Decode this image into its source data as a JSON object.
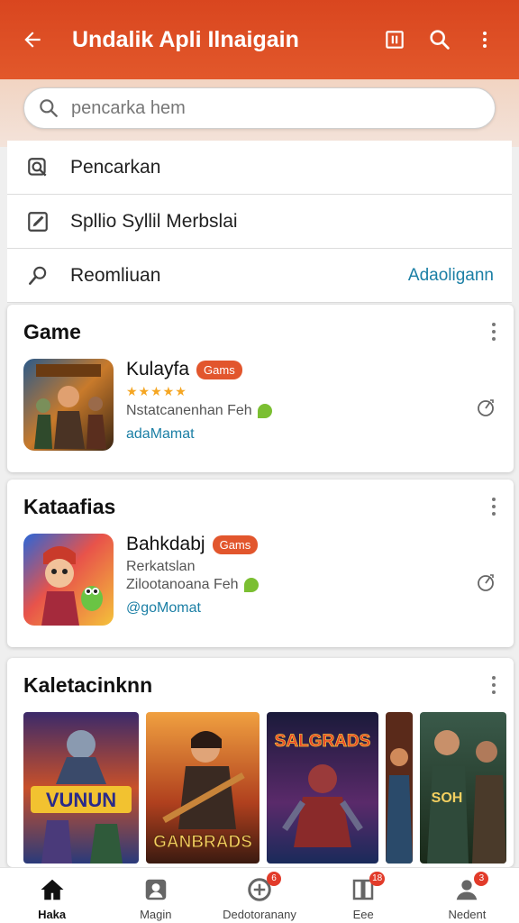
{
  "appbar": {
    "title": "Undalik Apli Ilnaigain",
    "icons": [
      "back-arrow-icon",
      "window-icon",
      "search-icon",
      "more-vertical-icon"
    ]
  },
  "search": {
    "placeholder": "pencarka hem"
  },
  "menu": [
    {
      "label": "Pencarkan",
      "icon": "search-square-icon"
    },
    {
      "label": "Spllio Syllil Merbslai",
      "icon": "edit-square-icon"
    },
    {
      "label": "Reomliuan",
      "icon": "search-icon",
      "link": "Adaoligann"
    }
  ],
  "sections": [
    {
      "title": "Game",
      "app": {
        "name": "Kulayfa",
        "badge": "Gams",
        "rating": "★★★★★",
        "subtitle": "Nstatcanenhan Feh",
        "developer": "adaMamat"
      }
    },
    {
      "title": "Kataafias",
      "app": {
        "name": "Bahkdabj",
        "badge": "Gams",
        "subtitle1": "Rerkatslan",
        "subtitle2": "Zilootanoana Feh",
        "developer": "@goMomat"
      }
    },
    {
      "title": "Kaletacinknn",
      "tiles": [
        {
          "caption": "VUNUN"
        },
        {
          "caption": "GANBRADS"
        },
        {
          "caption": "SALGRADS"
        },
        {
          "caption": ""
        },
        {
          "caption": "SOH"
        }
      ]
    }
  ],
  "bottom_nav": [
    {
      "label": "Haka",
      "icon": "home-icon",
      "active": true,
      "badge": ""
    },
    {
      "label": "Magin",
      "icon": "account-box-icon",
      "badge": ""
    },
    {
      "label": "Dedotoranany",
      "icon": "circle-icon",
      "badge": "6"
    },
    {
      "label": "Eee",
      "icon": "book-icon",
      "badge": "18"
    },
    {
      "label": "Nedent",
      "icon": "person-icon",
      "badge": "3"
    }
  ],
  "colors": {
    "accent": "#e2562d",
    "link": "#1b7fa5",
    "star": "#f5a623"
  }
}
